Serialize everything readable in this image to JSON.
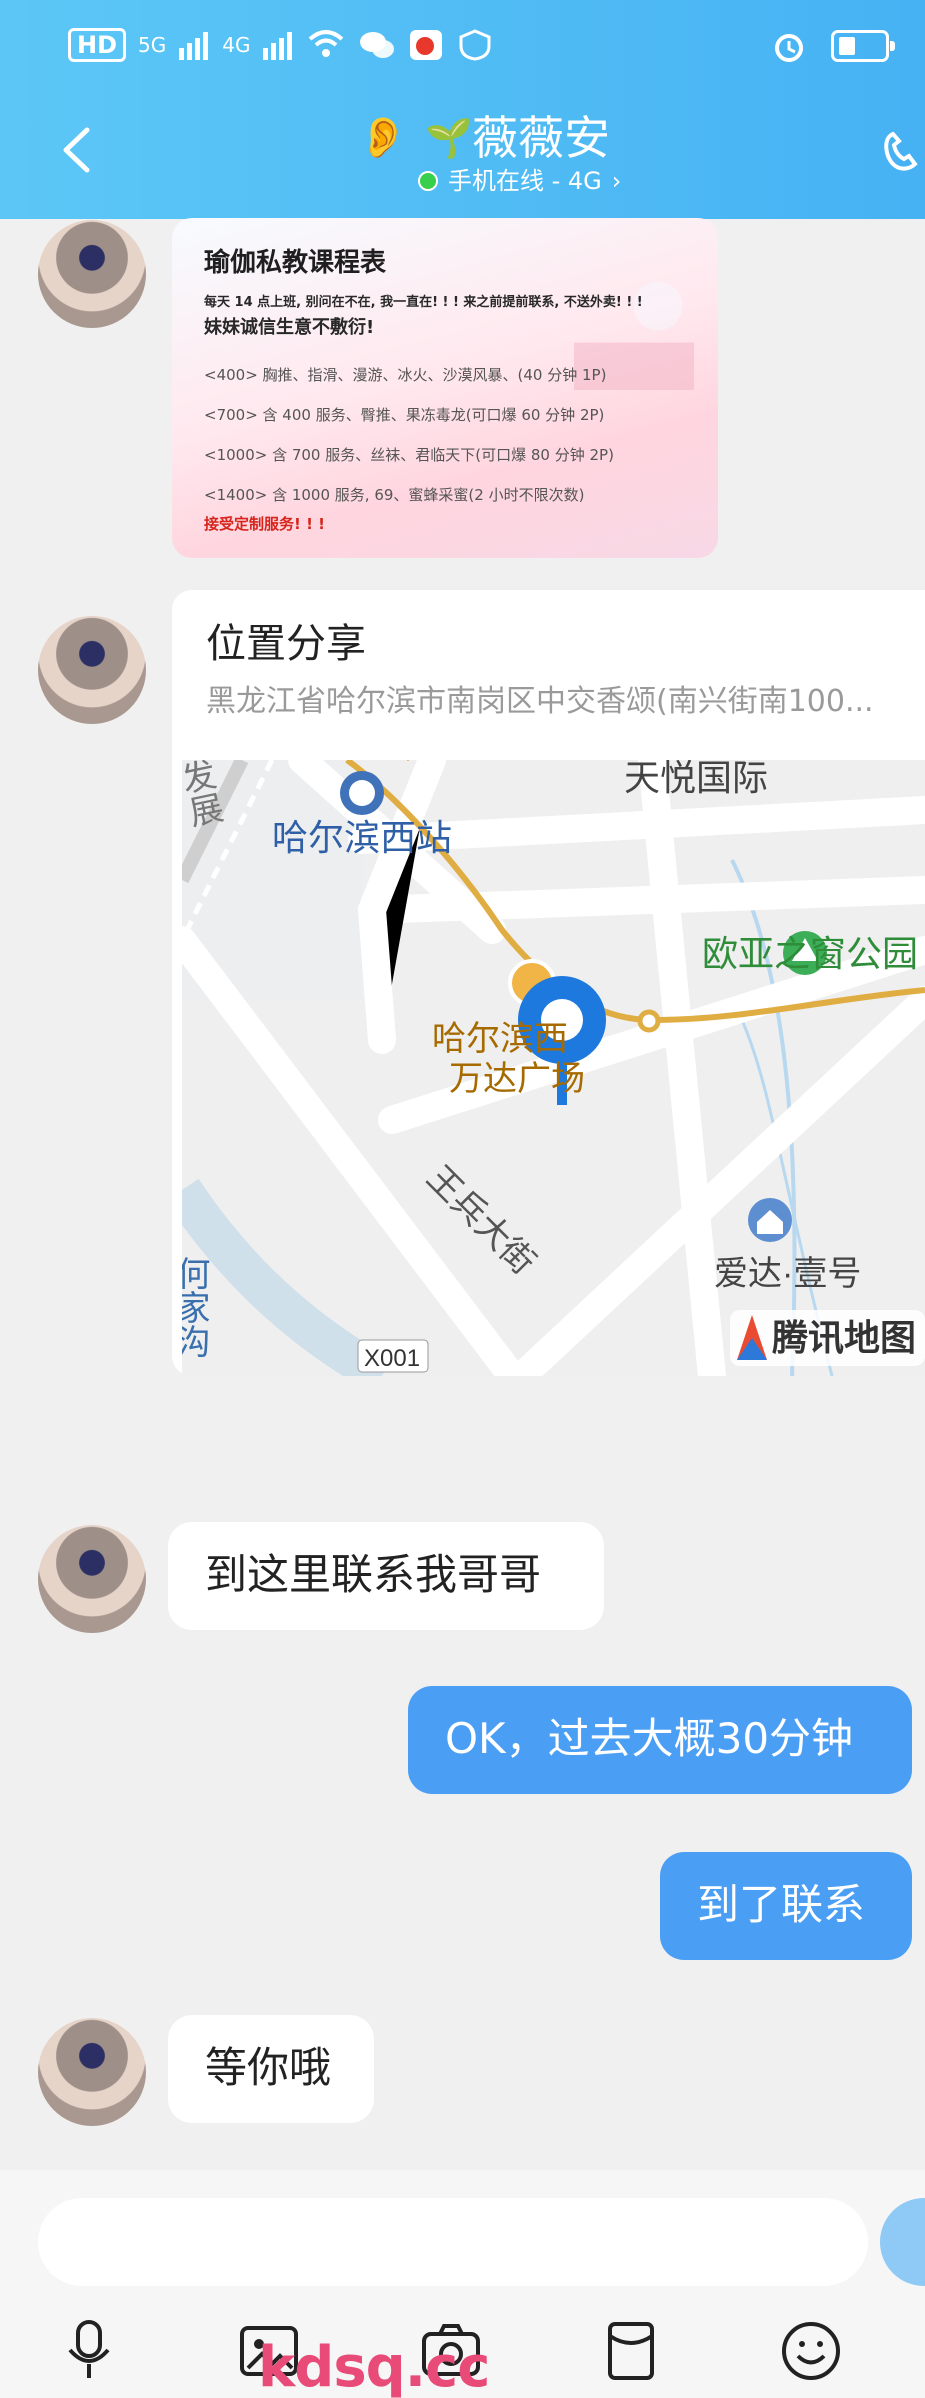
{
  "status_bar": {
    "hd_label": "HD",
    "signal_1": "5G",
    "signal_2": "4G"
  },
  "header": {
    "contact_name": "薇薇安",
    "presence": "手机在线 - 4G",
    "presence_arrow": "›"
  },
  "messages": {
    "yoga_card": {
      "title": "瑜伽私教课程表",
      "line1": "每天 14 点上班, 别问在不在, 我一直在! ! ! 来之前提前联系, 不送外卖! ! !",
      "line2": "妹妹诚信生意不敷衍!",
      "items": [
        "<400> 胸推、指滑、漫游、冰火、沙漠风暴、(40 分钟 1P)",
        "<700> 含 400 服务、臀推、果冻毒龙(可口爆 60 分钟 2P)",
        "<1000> 含 700 服务、丝袜、君临天下(可口爆 80 分钟 2P)",
        "<1400> 含 1000 服务, 69、蜜蜂采蜜(2 小时不限次数)"
      ],
      "footer": "接受定制服务! ! !"
    },
    "location_card": {
      "title": "位置分享",
      "address": "黑龙江省哈尔滨市南岗区中交香颂(南兴街南100...",
      "map_labels": {
        "railway_station": "哈尔滨西站",
        "tianyue": "天悦国际",
        "park": "欧亚之窗公园",
        "wanda_line1": "哈尔滨西",
        "wanda_line2": "万达广场",
        "wangbing": "王兵大街",
        "aida": "爱达·壹号",
        "hejia": "何家沟",
        "left_vertical": "发展",
        "road_code": "X001",
        "brand": "腾讯地图"
      }
    },
    "text_bubbles": [
      {
        "text": "到这里联系我哥哥",
        "from": "them"
      },
      {
        "text": "OK，过去大概30分钟",
        "from": "me"
      },
      {
        "text": "到了联系",
        "from": "me"
      },
      {
        "text": "等你哦",
        "from": "them"
      }
    ]
  },
  "watermark": "kdsq.cc",
  "colors": {
    "header_blue": "#46b2f3",
    "my_bubble": "#4a9ef4",
    "map_road": "#e0ad43"
  },
  "icons": {
    "back": "chevron-left-icon",
    "phone": "phone-icon",
    "voice": "microphone-icon",
    "image": "image-icon",
    "camera": "camera-icon",
    "package": "red-envelope-icon",
    "emoji": "emoji-icon"
  }
}
